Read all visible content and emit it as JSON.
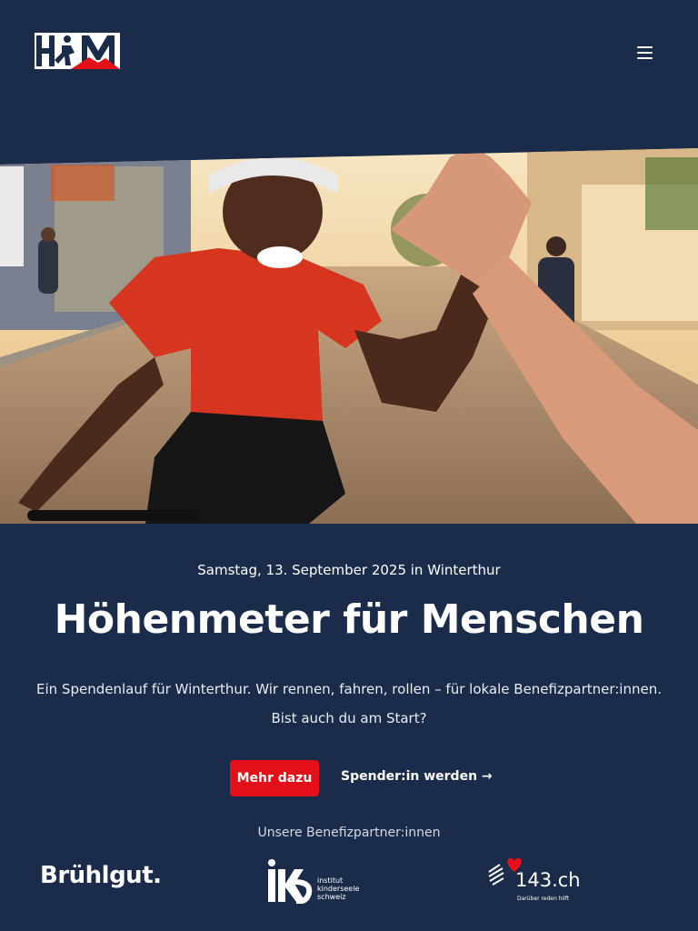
{
  "brand": {
    "logo_text": "HFM"
  },
  "header": {
    "menu_icon": "hamburger-menu-icon"
  },
  "hero": {
    "image": "cyclist-high-five-photo"
  },
  "event": {
    "date": "Samstag, 13. September 2025 in Winterthur",
    "title": "Höhenmeter für Menschen",
    "intro_line1": "Ein Spendenlauf für Winterthur. Wir rennen, fahren, rollen – für lokale Benefizpartner:innen.",
    "intro_line2": "Bist auch du am Start?"
  },
  "actions": {
    "primary": "Mehr dazu",
    "secondary": "Spender:in werden →"
  },
  "partners": {
    "heading": "Unsere Benefizpartner:innen",
    "items": [
      {
        "name": "Brühlgut."
      },
      {
        "name": "iks",
        "text": [
          "institut",
          "kinderseele",
          "schweiz"
        ]
      },
      {
        "name": "143.ch",
        "tagline": "Darüber reden hilft"
      }
    ]
  },
  "colors": {
    "background": "#1b2c4a",
    "accent": "#e3101a",
    "text": "#ffffff"
  }
}
